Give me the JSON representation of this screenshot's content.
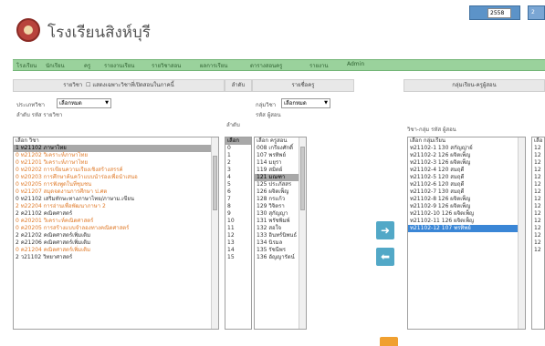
{
  "header": {
    "title": "โรงเรียนสิงห์บุรี",
    "year_value": "2558",
    "year_extra": "2"
  },
  "menu": [
    "โรงเรียน",
    "นักเรียน",
    "ครู",
    "รายงานเรียน",
    "รายวิชาสอน",
    "ผลการเรียน",
    "ตารางสอนครู",
    "รายงาน",
    "Admin"
  ],
  "columns": {
    "subjects": "รายวิชา",
    "subjects_note": "แสดงเฉพาะวิชาที่เปิดสอนในภาคนี้",
    "subject_no": "ลำดับ",
    "teachers": "รายชื่อครู",
    "groups": "กลุ่มเรียน-ครูผู้สอน"
  },
  "filters": {
    "subjects_label": "ประเภทวิชา",
    "subjects_select": "เลือกหมด",
    "subjects_sort": "ลำดับ รหัส รายวิชา",
    "teachers_label": "กลุ่มวิชา",
    "teachers_select": "เลือกหมด",
    "teachers_sort": "รหัส ผู้สอน",
    "groups_sort": "วิชา-กลุ่ม รหัส ผู้สอน"
  },
  "subjects_list": [
    {
      "text": "เลือก วิชา",
      "style": "normal"
    },
    {
      "text": "1 ท21102 ภาษาไทย",
      "style": "sel"
    },
    {
      "text": "0 ท21202 วิเคราะห์ภาษาไทย",
      "style": "orange"
    },
    {
      "text": "0 ท21201 วิเคราะห์ภาษาไทย",
      "style": "orange"
    },
    {
      "text": "0 ท20202 การเขียนความเรียงเชิงสร้างสรรค์",
      "style": "orange"
    },
    {
      "text": "0 ท20203 การศึกษาค้นคว้าแบบนำร่องเพื่อนำเสนอ",
      "style": "orange"
    },
    {
      "text": "0 ท20205 การฟังพูดในที่ชุมชน",
      "style": "orange"
    },
    {
      "text": "0 ท21207 สมุดจดงานการศึกษา ป.ศต",
      "style": "orange"
    },
    {
      "text": "0 ท21102 เสริมทักษะทางภาษาไทย/ภาษาม.เขียน",
      "style": "normal"
    },
    {
      "text": "2 ท22204 การอ่านเพื่อพัฒนาภาษา 2",
      "style": "orange"
    },
    {
      "text": "2 ค21102 คณิตศาสตร์",
      "style": "normal"
    },
    {
      "text": "0 ค20201 วิเคราะห์คณิตศาสตร์",
      "style": "orange"
    },
    {
      "text": "0 ค20205 การสร้างแบบจำลองทางคณิตศาสตร์",
      "style": "orange"
    },
    {
      "text": "2 ค21202 คณิตศาสตร์เพิ่มเติม",
      "style": "normal"
    },
    {
      "text": "2 ค21206 คณิตศาสตร์เพิ่มเติม",
      "style": "normal"
    },
    {
      "text": "0 ค21204 คณิตศาสตร์เพิ่มเติม",
      "style": "orange"
    },
    {
      "text": "2 ว21102 วิทยาศาสตร์",
      "style": "normal"
    }
  ],
  "numbers_list": [
    "เลือก",
    "0",
    "1",
    "2",
    "3",
    "4",
    "5",
    "6",
    "7",
    "8",
    "9",
    "10",
    "11",
    "12",
    "13",
    "14",
    "15"
  ],
  "teachers_list": [
    {
      "text": "เลือก ครูสอน",
      "style": "normal"
    },
    {
      "text": "008 เกรียงศักดิ์",
      "style": "normal"
    },
    {
      "text": "107 พรทิพย์",
      "style": "normal"
    },
    {
      "text": "114 มยุรา",
      "style": "normal"
    },
    {
      "text": "119 สมิตย์",
      "style": "normal"
    },
    {
      "text": "121 มณฑา",
      "style": "sel"
    },
    {
      "text": "125 ประภัสสร",
      "style": "normal"
    },
    {
      "text": "126 ผจิตเพ็ญ",
      "style": "normal"
    },
    {
      "text": "128 กรแก้ว",
      "style": "normal"
    },
    {
      "text": "129 วิจิตรา",
      "style": "normal"
    },
    {
      "text": "130 สุกัญญา",
      "style": "normal"
    },
    {
      "text": "131 พรัชพิมพ์",
      "style": "normal"
    },
    {
      "text": "132 สอใจ",
      "style": "normal"
    },
    {
      "text": "133 อินทร์นิพนธ์",
      "style": "normal"
    },
    {
      "text": "134 นิรมล",
      "style": "normal"
    },
    {
      "text": "135 รัชนีพร",
      "style": "normal"
    },
    {
      "text": "136 อัญญารัตน์",
      "style": "normal"
    }
  ],
  "groups_list": [
    {
      "text": "เลือก กลุ่มเรียน",
      "style": "normal"
    },
    {
      "text": "ท21102-1 130 สกัญญ่าย์",
      "style": "normal"
    },
    {
      "text": "ท21102-2 126 ผจิตเพ็ญ",
      "style": "normal"
    },
    {
      "text": "ท21102-3 126 ผจิตเพ็ญ",
      "style": "normal"
    },
    {
      "text": "ท21102-4 120 สมฤดี",
      "style": "normal"
    },
    {
      "text": "ท21102-5 120 สมฤดี",
      "style": "normal"
    },
    {
      "text": "ท21102-6 120 สมฤดี",
      "style": "normal"
    },
    {
      "text": "ท21102-7 130 สมฤดี",
      "style": "normal"
    },
    {
      "text": "ท21102-8 126 ผจิตเพ็ญ",
      "style": "normal"
    },
    {
      "text": "ท21102-9 126 ผจิตเพ็ญ",
      "style": "normal"
    },
    {
      "text": "ท21102-10 126 ผจิตเพ็ญ",
      "style": "normal"
    },
    {
      "text": "ท21102-11 126 ผจิตเพ็ญ",
      "style": "normal"
    },
    {
      "text": "ท21102-12 107 พรทิพย์",
      "style": "sel-blue"
    }
  ],
  "right_numbers": [
    "เลือ",
    "12",
    "12",
    "12",
    "12",
    "12",
    "12",
    "12",
    "12",
    "12",
    "12",
    "12",
    "12",
    "12",
    "12",
    "12"
  ],
  "buttons": {
    "add": "➜",
    "remove": "⬅"
  }
}
